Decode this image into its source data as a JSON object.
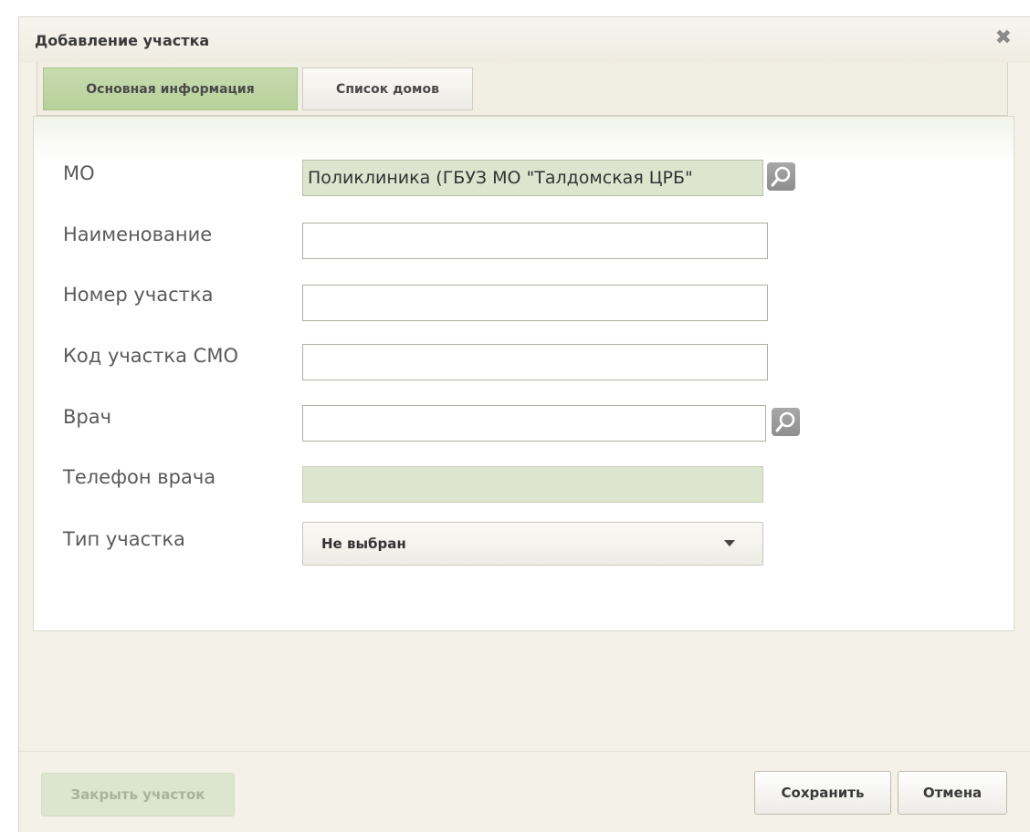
{
  "dialog": {
    "title": "Добавление участка",
    "close_glyph": "✖"
  },
  "tabs": [
    {
      "label": "Основная информация",
      "active": true
    },
    {
      "label": "Список домов",
      "active": false
    }
  ],
  "form": {
    "mo": {
      "label": "МО",
      "value": "Поликлиника (ГБУЗ МО \"Талдомская ЦРБ\""
    },
    "name": {
      "label": "Наименование",
      "value": ""
    },
    "number": {
      "label": "Номер участка",
      "value": ""
    },
    "smo_code": {
      "label": "Код участка СМО",
      "value": ""
    },
    "doctor": {
      "label": "Врач",
      "value": ""
    },
    "doctor_phone": {
      "label": "Телефон врача",
      "value": ""
    },
    "type": {
      "label": "Тип участка",
      "selected": "Не выбран"
    }
  },
  "footer": {
    "close_area_label": "Закрыть участок",
    "save_label": "Сохранить",
    "cancel_label": "Отмена"
  },
  "colors": {
    "active_tab": "#b7d09a",
    "readonly_field": "#dde5cf",
    "search_button": "#9a9a9a"
  },
  "icons": {
    "search": "search-icon",
    "dropdown": "caret-down-icon",
    "close": "close-icon"
  }
}
